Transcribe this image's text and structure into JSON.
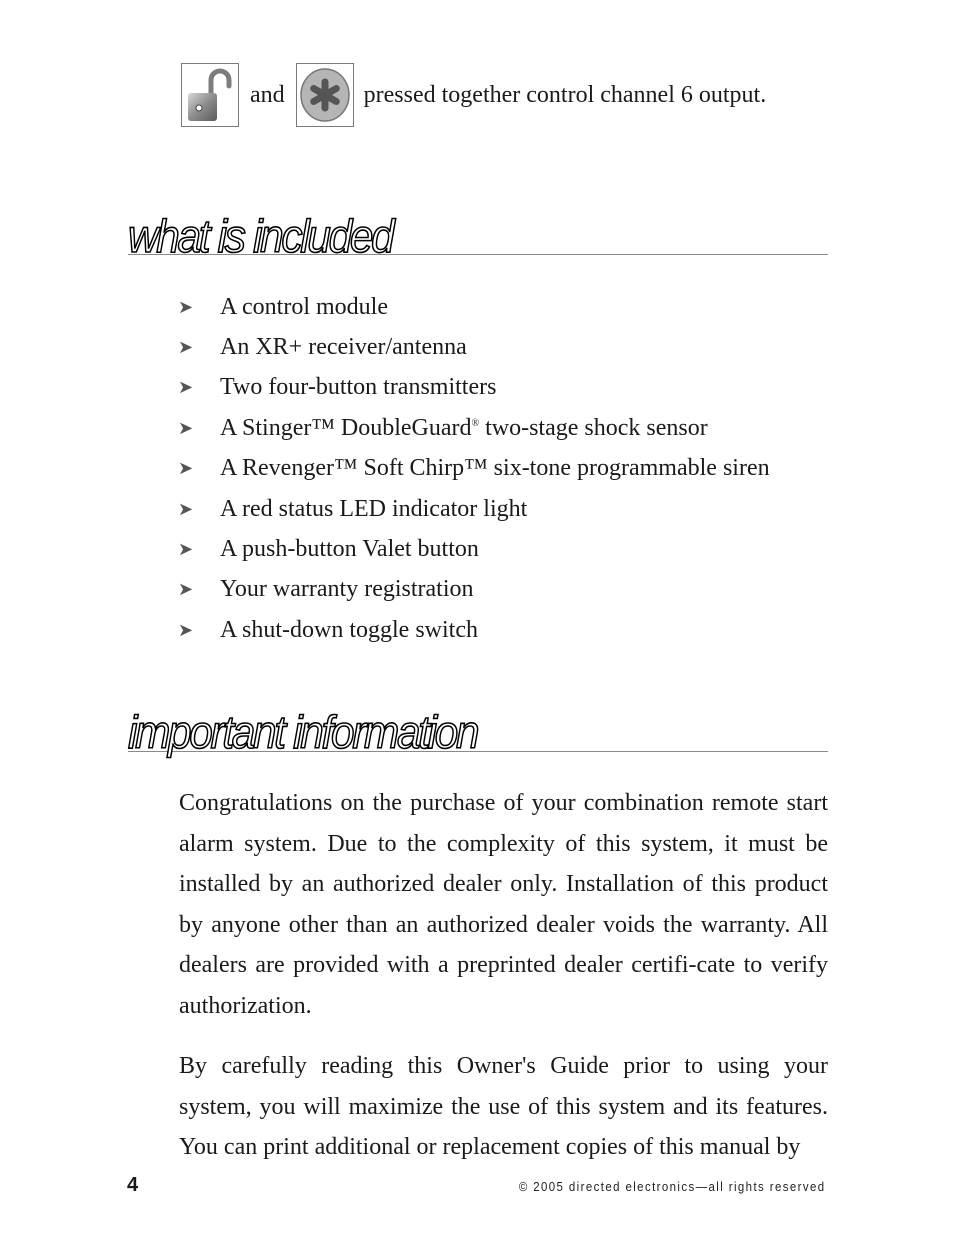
{
  "top_instruction": {
    "icons": [
      "unlock-button-icon",
      "asterisk-button-icon"
    ],
    "connector": "and",
    "text": "pressed together control channel 6 output."
  },
  "sections": [
    {
      "heading": "what is included",
      "items": [
        {
          "text": "A control module"
        },
        {
          "text": "An XR+ receiver/antenna"
        },
        {
          "text": "Two four-button transmitters"
        },
        {
          "text_before": "A Stinger™ DoubleGuard",
          "superscript": "®",
          "text_after": " two-stage shock sensor"
        },
        {
          "text": "A Revenger™ Soft Chirp™ six-tone programmable siren"
        },
        {
          "text": "A red status LED indicator light"
        },
        {
          "text": "A push-button Valet button"
        },
        {
          "text": "Your warranty registration"
        },
        {
          "text": "A shut-down toggle switch"
        }
      ]
    },
    {
      "heading": "important information",
      "paragraphs": [
        "Congratulations on the purchase of your combination remote start alarm system. Due to the complexity of this system, it must be installed by an authorized dealer only. Installation of this product by anyone other than an authorized dealer voids the warranty. All dealers are provided with a preprinted dealer certifi-cate to verify authorization.",
        "By carefully reading this Owner's Guide prior to using your system, you will maximize the use of this system and its features. You can print additional or replacement copies of this manual by"
      ]
    }
  ],
  "footer": {
    "page_number": "4",
    "copyright": "© 2005 directed electronics—all rights reserved"
  }
}
